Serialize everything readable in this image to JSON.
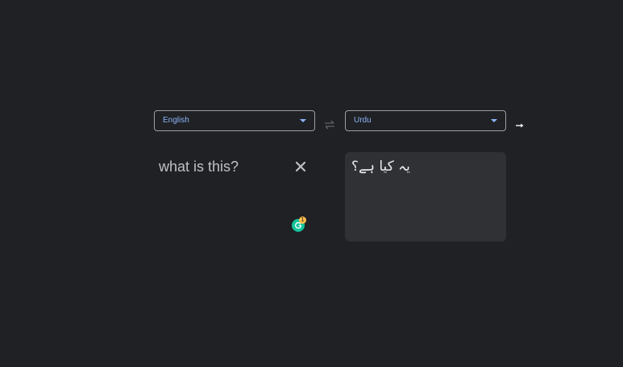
{
  "source_language": {
    "selected": "English"
  },
  "target_language": {
    "selected": "Urdu"
  },
  "input": {
    "text": "what is this?"
  },
  "output": {
    "text": "یہ کیا ہے؟"
  },
  "grammarly": {
    "badge_count": "1"
  },
  "icons": {
    "swap": "swap-arrows-icon",
    "go": "arrow-right-icon",
    "clear": "close-icon",
    "grammarly": "grammarly-icon"
  },
  "colors": {
    "background": "#202124",
    "accent": "#8ab4f8",
    "result_bg": "#303134",
    "text_primary": "#bdc1c6",
    "grammarly_green": "#15c39a",
    "badge": "#ffbe4d"
  }
}
